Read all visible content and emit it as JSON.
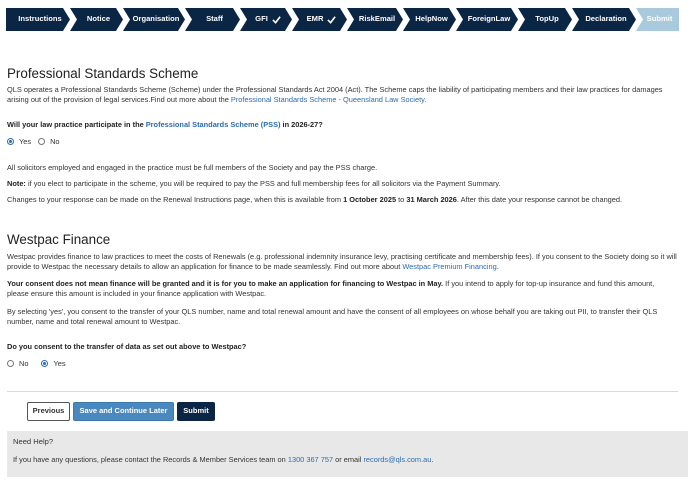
{
  "steps": [
    {
      "label": "Instructions",
      "check": false
    },
    {
      "label": "Notice",
      "check": false
    },
    {
      "label": "Organisation",
      "check": false
    },
    {
      "label": "Staff",
      "check": false
    },
    {
      "label": "GFI",
      "check": true
    },
    {
      "label": "EMR",
      "check": true
    },
    {
      "label": "RiskEmail",
      "check": false
    },
    {
      "label": "HelpNow",
      "check": false
    },
    {
      "label": "ForeignLaw",
      "check": false
    },
    {
      "label": "TopUp",
      "check": false
    },
    {
      "label": "Declaration",
      "check": false
    },
    {
      "label": "Submit",
      "check": false
    }
  ],
  "pss": {
    "heading": "Professional Standards Scheme",
    "intro_pre": "QLS operates a Professional Standards Scheme (Scheme) under the Professional Standards Act 2004 (Act). The Scheme caps the liability of participating members and their law practices for damages arising out of the provision of legal services.Find out more about the ",
    "intro_link": "Professional Standards Scheme - Queensland Law Society",
    "intro_post": ".",
    "question_pre": "Will your law practice participate in the ",
    "question_link": "Professional Standards Scheme (PSS)",
    "question_post": " in 2026-27?",
    "option_yes": "Yes",
    "option_no": "No",
    "selected": "Yes",
    "note_members": "All solicitors employed and engaged in the practice must be full members of the Society and pay the PSS charge.",
    "note_label": "Note:",
    "note_text": " if you elect to participate in the scheme, you will be required to pay the PSS and full membership fees for all solicitors via the Payment Summary.",
    "changes_pre": "Changes to your response can be made on the Renewal Instructions page, when this is available from ",
    "changes_from": "1 October 2025",
    "changes_mid": " to ",
    "changes_to": "31 March 2026",
    "changes_post": ". After this date your response cannot be changed."
  },
  "westpac": {
    "heading": "Westpac Finance",
    "intro_pre": "Westpac provides finance to law practices to meet the costs of Renewals (e.g. professional indemnity insurance levy, practising certificate and membership fees). If you consent to the Society doing so it will provide to Westpac the necessary details to allow an application for finance to be made seamlessly. Find out more about ",
    "intro_link": "Westpac Premium Financing",
    "intro_post": ".",
    "consent_bold": "Your consent does not mean finance will be granted and it is for you to make an application for financing to Westpac in May.",
    "consent_text": "  If you intend to apply for top-up insurance and fund this amount, please ensure this amount is included in your finance application with Westpac.",
    "by_selecting": "By selecting 'yes', you consent to the transfer of your QLS number, name and total renewal amount and have the consent of all employees on whose behalf you are taking out PII, to transfer their QLS number, name and total renewal amount to Westpac.",
    "question": "Do you consent to the transfer of data as set out above to Westpac?",
    "option_no": "No",
    "option_yes": "Yes",
    "selected": "Yes"
  },
  "buttons": {
    "previous": "Previous",
    "save": "Save and Continue Later",
    "submit": "Submit"
  },
  "help": {
    "title": "Need Help?",
    "text_pre": "If you have any questions, please contact the Records & Member Services team on ",
    "phone": "1300 367 757",
    "text_mid": " or email ",
    "email": "records@qls.com.au",
    "text_post": "."
  }
}
